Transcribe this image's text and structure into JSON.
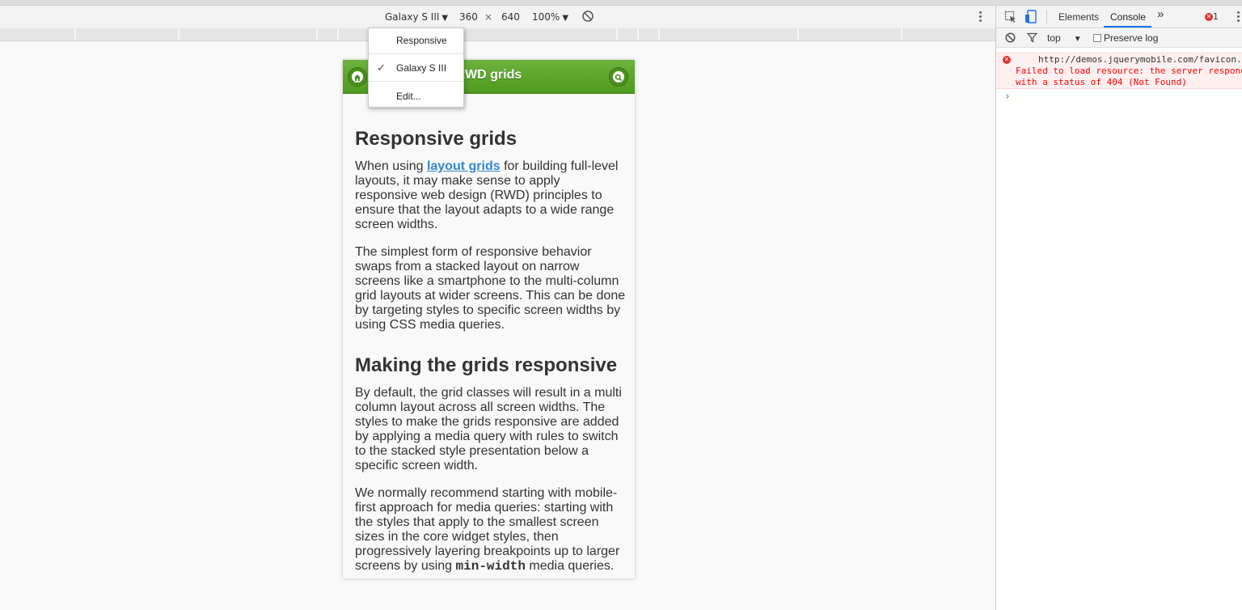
{
  "device_toolbar": {
    "device_name": "Galaxy S III",
    "width": "360",
    "times": "×",
    "height": "640",
    "zoom": "100%"
  },
  "device_menu": {
    "options": [
      {
        "label": "Responsive",
        "checked": false
      },
      {
        "label": "Galaxy S III",
        "checked": true
      },
      {
        "label": "Edit...",
        "checked": false
      }
    ]
  },
  "page": {
    "header_title": "RWD grids",
    "h1": "Responsive grids",
    "p1_before": "When using ",
    "p1_link": "layout grids",
    "p1_after": " for building full-level layouts, it may make sense to apply responsive web design (RWD) principles to ensure that the layout adapts to a wide range screen widths.",
    "p2": "The simplest form of responsive behavior swaps from a stacked layout on narrow screens like a smartphone to the multi-column grid layouts at wider screens. This can be done by targeting styles to specific screen widths by using CSS media queries.",
    "h2": "Making the grids responsive",
    "p3": "By default, the grid classes will result in a multi column layout across all screen widths. The styles to make the grids responsive are added by applying a media query with rules to switch to the stacked style presentation below a specific screen width.",
    "p4_before": "We normally recommend starting with mobile-first approach for media queries: starting with the styles that apply to the smallest screen sizes in the core widget styles, then progressively layering breakpoints up to larger screens by using ",
    "p4_code": "min-width",
    "p4_after": " media queries."
  },
  "devtools": {
    "tabs": [
      "Elements",
      "Console"
    ],
    "active_tab": "Console",
    "more": "»",
    "error_count": "1",
    "context": "top",
    "preserve_log": "Preserve log",
    "error_url": "http://demos.jquerymobile.com/favicon.ico",
    "error_line1": "Failed to load resource: the server responded",
    "error_line2": "with a status of 404 (Not Found)"
  },
  "colors": {
    "header_green": "#5aa826",
    "link_blue": "#3388cc",
    "error_red": "#ff0000",
    "active_tab_blue": "#1a73e8"
  }
}
